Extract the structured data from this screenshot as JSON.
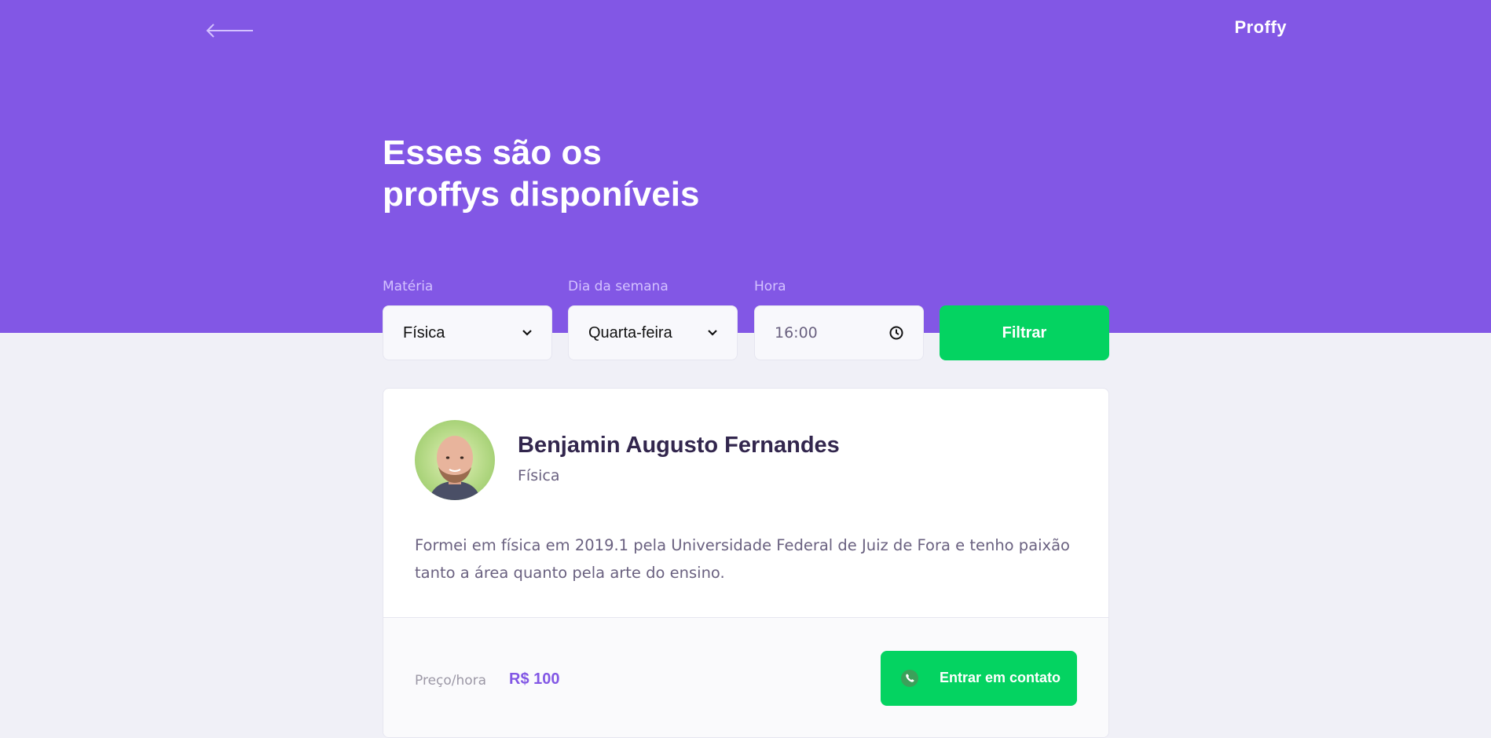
{
  "header": {
    "back_icon": "arrow-left-icon",
    "logo_text": "Proffy"
  },
  "page": {
    "title_line1": "Esses são os",
    "title_line2": "proffys disponíveis"
  },
  "filters": {
    "subject": {
      "label": "Matéria",
      "value": "Física"
    },
    "weekday": {
      "label": "Dia da semana",
      "value": "Quarta-feira"
    },
    "time": {
      "label": "Hora",
      "value": "16:00"
    },
    "submit_label": "Filtrar"
  },
  "teacher": {
    "name": "Benjamin Augusto Fernandes",
    "subject": "Física",
    "bio": "Formei em física em 2019.1 pela Universidade Federal de Juiz de Fora e tenho paixão tanto a área quanto pela arte do ensino.",
    "price_label": "Preço/hora",
    "price_value": "R$ 100",
    "contact_label": "Entrar em contato",
    "contact_icon": "whatsapp-icon"
  },
  "colors": {
    "primary": "#8257E5",
    "secondary": "#04D361",
    "background": "#F0F0F7",
    "title_text": "#32264D",
    "body_text": "#6A6180"
  }
}
